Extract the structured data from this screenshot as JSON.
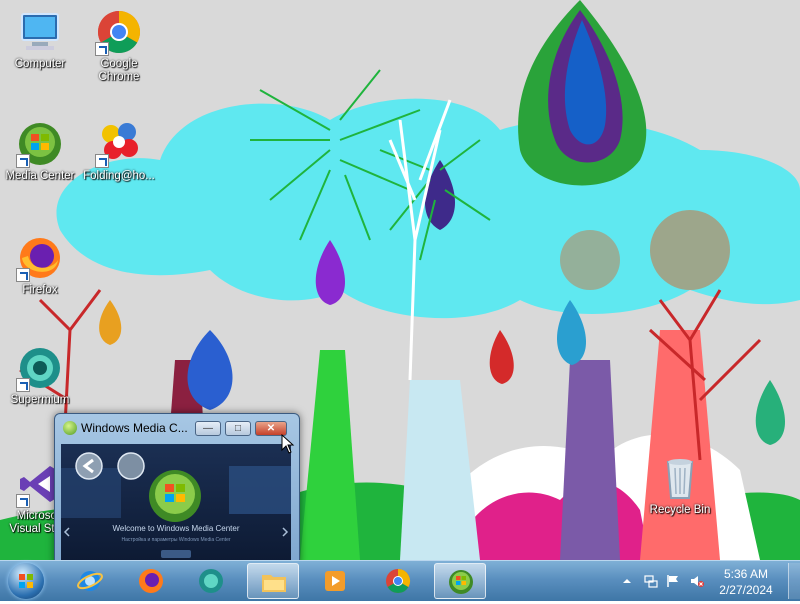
{
  "desktop_icons": [
    {
      "id": "computer",
      "label": "Computer",
      "icon": "computer-icon"
    },
    {
      "id": "chrome",
      "label": "Google Chrome",
      "icon": "chrome-icon"
    },
    {
      "id": "media-center",
      "label": "Media Center",
      "icon": "windows-media-center-icon"
    },
    {
      "id": "folding",
      "label": "Folding@ho...",
      "icon": "folding-at-home-icon"
    },
    {
      "id": "firefox",
      "label": "Firefox",
      "icon": "firefox-icon"
    },
    {
      "id": "supermium",
      "label": "Supermium",
      "icon": "supermium-icon"
    },
    {
      "id": "visual-studio",
      "label": "Microsoft Visual Stu...",
      "icon": "visual-studio-icon"
    },
    {
      "id": "recycle-bin",
      "label": "Recycle Bin",
      "icon": "recycle-bin-icon"
    }
  ],
  "media_center_window": {
    "title": "Windows Media C...",
    "minimize_symbol": "—",
    "maximize_symbol": "□",
    "close_symbol": "✕",
    "welcome_text": "Welcome to Windows Media Center",
    "sub_text": "Настройка и параметры Windows Media Center"
  },
  "taskbar": {
    "apps": [
      {
        "name": "internet-explorer",
        "icon": "internet-explorer-icon",
        "active": false
      },
      {
        "name": "firefox",
        "icon": "firefox-icon",
        "active": false
      },
      {
        "name": "supermium",
        "icon": "supermium-icon",
        "active": false
      },
      {
        "name": "windows-explorer",
        "icon": "folder-icon",
        "active": true
      },
      {
        "name": "windows-media-player",
        "icon": "media-player-icon",
        "active": false
      },
      {
        "name": "google-chrome",
        "icon": "chrome-icon",
        "active": false
      },
      {
        "name": "windows-media-center",
        "icon": "windows-media-center-icon",
        "active": true
      }
    ],
    "clock": {
      "time": "5:36 AM",
      "date": "2/27/2024"
    },
    "tray_icons": [
      "show-hidden-icons-arrow-icon",
      "network-icon",
      "action-center-flag-icon",
      "volume-muted-icon"
    ]
  }
}
